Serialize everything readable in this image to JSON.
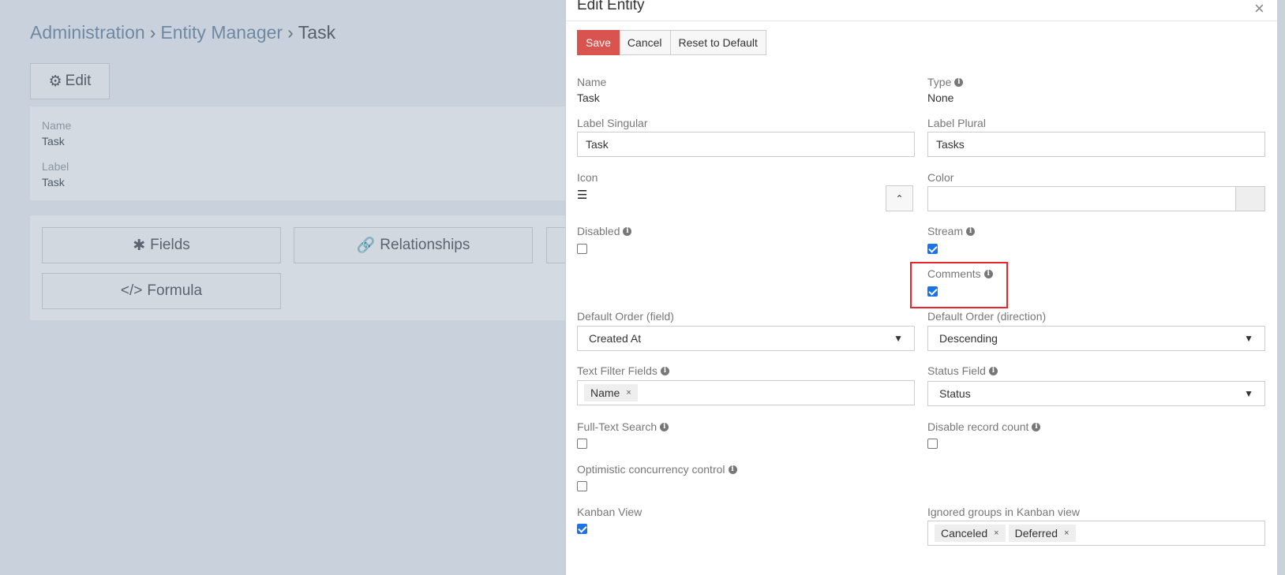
{
  "background": {
    "breadcrumb": [
      "Administration",
      "Entity Manager",
      "Task"
    ],
    "edit_button": "Edit",
    "fields": [
      {
        "label": "Name",
        "value": "Task"
      },
      {
        "label": "Label",
        "value": "Task"
      }
    ],
    "buttons": [
      "Fields",
      "Relationships",
      "Formula"
    ]
  },
  "modal": {
    "title": "Edit Entity",
    "close": "×",
    "buttons": {
      "save": "Save",
      "cancel": "Cancel",
      "reset": "Reset to Default"
    },
    "name": {
      "label": "Name",
      "value": "Task"
    },
    "type": {
      "label": "Type",
      "value": "None"
    },
    "label_singular": {
      "label": "Label Singular",
      "value": "Task"
    },
    "label_plural": {
      "label": "Label Plural",
      "value": "Tasks"
    },
    "icon": {
      "label": "Icon",
      "icon": "list-check-icon"
    },
    "color": {
      "label": "Color",
      "value": ""
    },
    "disabled": {
      "label": "Disabled",
      "checked": false
    },
    "stream": {
      "label": "Stream",
      "checked": true
    },
    "comments": {
      "label": "Comments",
      "checked": true
    },
    "default_order_field": {
      "label": "Default Order (field)",
      "value": "Created At"
    },
    "default_order_direction": {
      "label": "Default Order (direction)",
      "value": "Descending"
    },
    "text_filter_fields": {
      "label": "Text Filter Fields",
      "tags": [
        "Name"
      ]
    },
    "status_field": {
      "label": "Status Field",
      "value": "Status"
    },
    "full_text_search": {
      "label": "Full-Text Search",
      "checked": false
    },
    "disable_record_count": {
      "label": "Disable record count",
      "checked": false
    },
    "optimistic_concurrency": {
      "label": "Optimistic concurrency control",
      "checked": false
    },
    "kanban_view": {
      "label": "Kanban View",
      "checked": true
    },
    "ignored_groups": {
      "label": "Ignored groups in Kanban view",
      "tags": [
        "Canceled",
        "Deferred"
      ]
    }
  },
  "colors": {
    "highlight": "#e8262b",
    "save": "#d9534f",
    "checkbox": "#1a73e8"
  }
}
